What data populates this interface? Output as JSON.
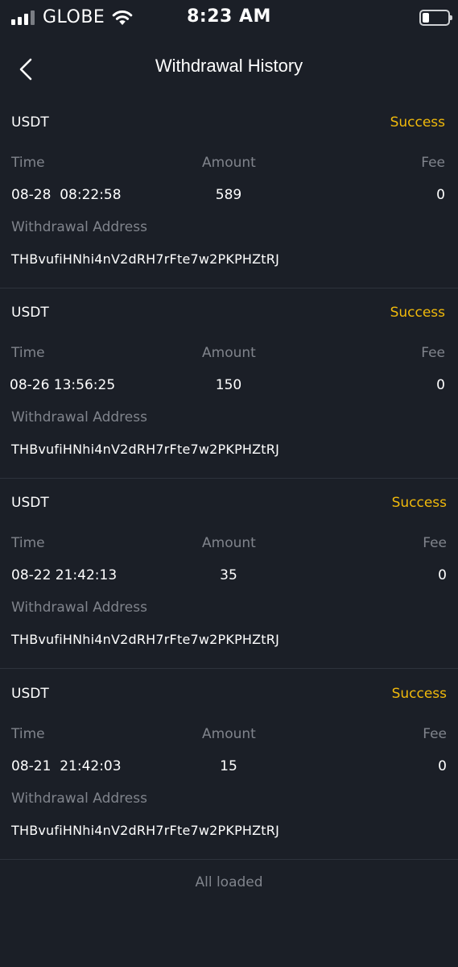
{
  "status_bar": {
    "carrier": "GLOBE",
    "time": "8:23 AM",
    "signal_icon": "signal-bars-icon",
    "wifi_icon": "wifi-icon",
    "battery_icon": "battery-icon",
    "battery_level": 0.25
  },
  "header": {
    "title": "Withdrawal History",
    "back_icon": "chevron-left-icon"
  },
  "labels": {
    "time": "Time",
    "amount": "Amount",
    "fee": "Fee",
    "address": "Withdrawal Address"
  },
  "records": [
    {
      "coin": "USDT",
      "status": "Success",
      "time": "08-28  08:22:58",
      "amount": "589",
      "fee": "0",
      "address": "THBvufiHNhi4nV2dRH7rFte7w2PKPHZtRJ"
    },
    {
      "coin": "USDT",
      "status": "Success",
      "time": "08-26 13:56:25",
      "amount": "150",
      "fee": "0",
      "address": "THBvufiHNhi4nV2dRH7rFte7w2PKPHZtRJ"
    },
    {
      "coin": "USDT",
      "status": "Success",
      "time": "08-22 21:42:13",
      "amount": "35",
      "fee": "0",
      "address": "THBvufiHNhi4nV2dRH7rFte7w2PKPHZtRJ"
    },
    {
      "coin": "USDT",
      "status": "Success",
      "time": "08-21  21:42:03",
      "amount": "15",
      "fee": "0",
      "address": "THBvufiHNhi4nV2dRH7rFte7w2PKPHZtRJ"
    }
  ],
  "footer": {
    "all_loaded": "All loaded"
  },
  "colors": {
    "background": "#1b1f27",
    "success": "#f0b90b",
    "muted": "#80848c",
    "divider": "#2e333c"
  }
}
